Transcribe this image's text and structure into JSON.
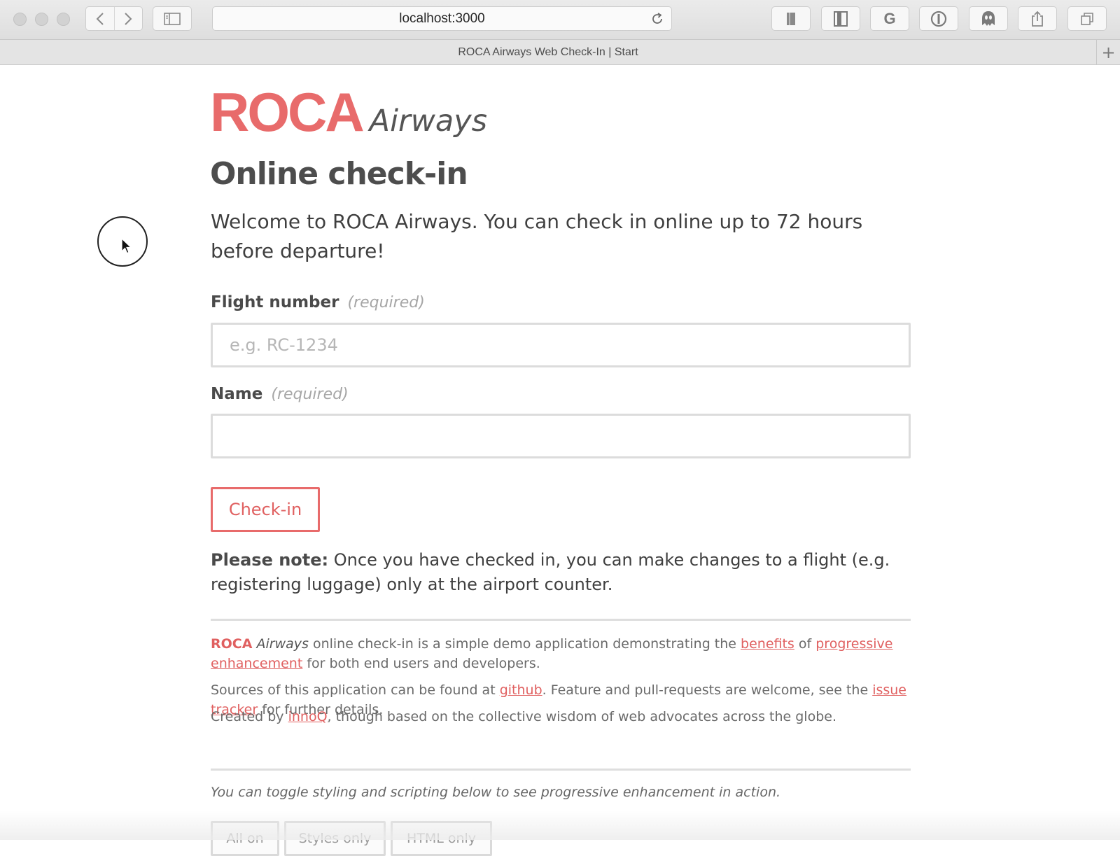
{
  "browser": {
    "address": "localhost:3000",
    "tab_title": "ROCA Airways Web Check-In | Start",
    "new_tab_symbol": "+",
    "toolbar_icons": [
      "back-icon",
      "forward-icon",
      "sidebar-icon",
      "reload-icon",
      "bookmark-icon",
      "readability-icon",
      "google-icon",
      "onepassword-icon",
      "ghostery-icon",
      "share-icon",
      "tabs-icon"
    ],
    "google_letter": "G"
  },
  "logo": {
    "brand": "ROCA",
    "suffix": "Airways",
    "brand_color": "#e86b6b"
  },
  "main": {
    "title": "Online check-in",
    "welcome": "Welcome to ROCA Airways. You can check in online up to 72 hours before departure!"
  },
  "form": {
    "flight_label": "Flight number",
    "flight_required": "(required)",
    "flight_placeholder": "e.g. RC-1234",
    "flight_value": "",
    "name_label": "Name",
    "name_required": "(required)",
    "name_value": "",
    "submit_label": "Check-in"
  },
  "note": {
    "lead": "Please note:",
    "text": " Once you have checked in, you can make changes to a flight (e.g. registering luggage) only at the airport counter."
  },
  "footer": {
    "about_brand": "ROCA",
    "about_brand_suffix": "Airways",
    "about_text_1": " online check-in is a simple demo application demonstrating the ",
    "about_link_benefits": "benefits",
    "about_text_2": " of ",
    "about_link_pe": "progressive enhancement",
    "about_text_3": " for both end users and developers.",
    "sources_text_1": "Sources of this application can be found at ",
    "sources_link_github": "github",
    "sources_text_2": ". Feature and pull-requests are welcome, see the ",
    "sources_link_tracker": "issue tracker",
    "sources_text_3": " for further details.",
    "created_text_1": "Created by ",
    "created_link_innoq": "innoQ",
    "created_text_2": ", though based on the collective wisdom of web advocates across the globe.",
    "toggle_hint": "You can toggle styling and scripting below to see progressive enhancement in action.",
    "toggle_buttons": [
      "All on",
      "Styles only",
      "HTML only"
    ]
  },
  "colors": {
    "accent": "#e86b6b",
    "text": "#4a4a4a",
    "muted": "#a6a6a6"
  }
}
